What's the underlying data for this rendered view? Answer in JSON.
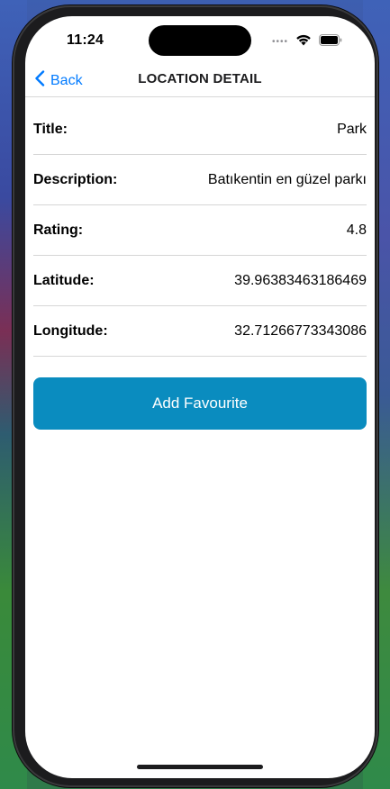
{
  "status_bar": {
    "time": "11:24",
    "signal": "••••"
  },
  "nav": {
    "back_label": "Back",
    "title": "LOCATION DETAIL"
  },
  "details": [
    {
      "label": "Title:",
      "value": "Park"
    },
    {
      "label": "Description:",
      "value": "Batıkentin en güzel parkı"
    },
    {
      "label": "Rating:",
      "value": "4.8"
    },
    {
      "label": "Latitude:",
      "value": "39.96383463186469"
    },
    {
      "label": "Longitude:",
      "value": "32.71266773343086"
    }
  ],
  "action": {
    "add_favourite_label": "Add Favourite"
  },
  "colors": {
    "accent": "#007aff",
    "button": "#0a8cbf"
  },
  "icons": [
    "chevron-left-icon",
    "wifi-icon",
    "battery-icon"
  ]
}
